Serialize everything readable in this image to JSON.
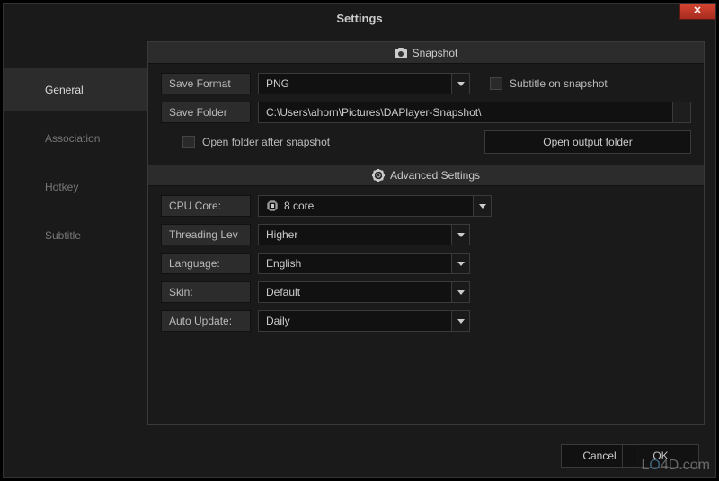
{
  "window": {
    "title": "Settings"
  },
  "sidebar": {
    "tabs": [
      {
        "label": "General"
      },
      {
        "label": "Association"
      },
      {
        "label": "Hotkey"
      },
      {
        "label": "Subtitle"
      }
    ]
  },
  "snapshot": {
    "section_title": "Snapshot",
    "save_format_label": "Save Format",
    "save_format_value": "PNG",
    "subtitle_on_snapshot_label": "Subtitle on snapshot",
    "save_folder_label": "Save Folder",
    "save_folder_value": "C:\\Users\\ahorn\\Pictures\\DAPlayer-Snapshot\\",
    "open_folder_after_label": "Open folder after snapshot",
    "open_output_folder_btn": "Open output folder"
  },
  "advanced": {
    "section_title": "Advanced Settings",
    "cpu_core_label": "CPU Core:",
    "cpu_core_value": "8 core",
    "threading_label": "Threading Lev",
    "threading_value": "Higher",
    "language_label": "Language:",
    "language_value": "English",
    "skin_label": "Skin:",
    "skin_value": "Default",
    "auto_update_label": "Auto Update:",
    "auto_update_value": "Daily"
  },
  "footer": {
    "cancel": "Cancel",
    "ok": "OK"
  },
  "watermark": "LO4D.com"
}
